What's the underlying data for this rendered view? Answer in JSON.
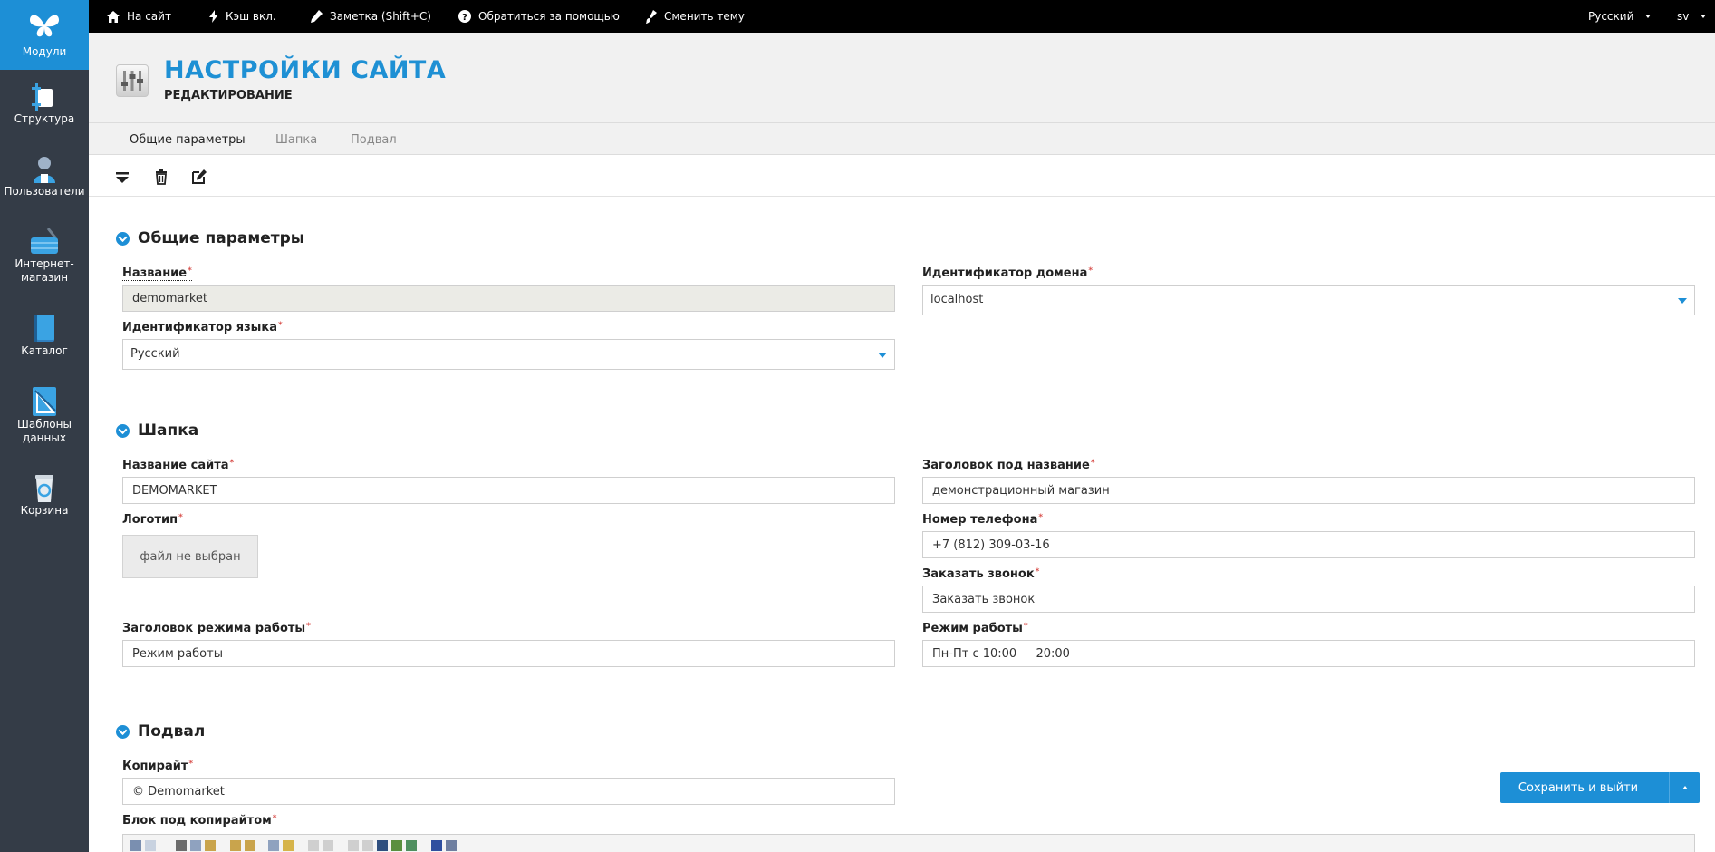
{
  "sidebar": {
    "items": [
      {
        "label": "Модули",
        "icon": "butterfly-icon"
      },
      {
        "label": "Структура",
        "icon": "structure-icon"
      },
      {
        "label": "Пользователи",
        "icon": "user-icon"
      },
      {
        "label": "Интернет-магазин",
        "icon": "basket-icon"
      },
      {
        "label": "Каталог",
        "icon": "book-icon"
      },
      {
        "label": "Шаблоны данных",
        "icon": "ruler-icon"
      },
      {
        "label": "Корзина",
        "icon": "trash-bin-icon"
      }
    ]
  },
  "topbar": {
    "to_site": "На сайт",
    "cache": "Кэш вкл.",
    "note": "Заметка (Shift+C)",
    "help": "Обратиться за помощью",
    "theme": "Сменить тему",
    "language": "Русский",
    "user": "sv"
  },
  "header": {
    "title": "НАСТРОЙКИ САЙТА",
    "subtitle": "РЕДАКТИРОВАНИЕ"
  },
  "tabs": [
    "Общие параметры",
    "Шапка",
    "Подвал"
  ],
  "sections": {
    "general": {
      "title": "Общие параметры",
      "name_label": "Название",
      "name_value": "demomarket",
      "lang_label": "Идентификатор языка",
      "lang_value": "Русский",
      "domain_label": "Идентификатор домена",
      "domain_value": "localhost"
    },
    "header": {
      "title": "Шапка",
      "site_name_label": "Название сайта",
      "site_name_value": "DEMOMARKET",
      "logo_label": "Логотип",
      "logo_value": "файл не выбран",
      "work_title_label": "Заголовок режима работы",
      "work_title_value": "Режим работы",
      "subtitle_label": "Заголовок под название",
      "subtitle_value": "демонстрационный магазин",
      "phone_label": "Номер телефона",
      "phone_value": "+7 (812) 309-03-16",
      "callback_label": "Заказать звонок",
      "callback_value": "Заказать звонок",
      "work_mode_label": "Режим работы",
      "work_mode_value": "Пн-Пт с 10:00 — 20:00"
    },
    "footer": {
      "title": "Подвал",
      "copyright_label": "Копирайт",
      "copyright_value": "© Demomarket",
      "block_label": "Блок под копирайтом"
    }
  },
  "save_button": "Сохранить и выйти",
  "colors": {
    "accent": "#1d8fd6",
    "sidebar": "#343c47",
    "topbar": "#000000"
  }
}
